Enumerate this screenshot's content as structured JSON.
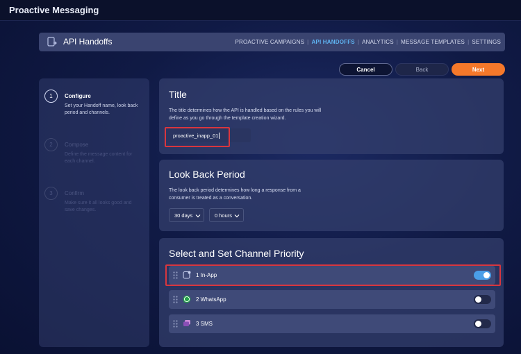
{
  "app": {
    "title": "Proactive Messaging"
  },
  "header": {
    "title": "API Handoffs",
    "nav": [
      {
        "label": "PROACTIVE CAMPAIGNS",
        "active": false
      },
      {
        "label": "API HANDOFFS",
        "active": true
      },
      {
        "label": "ANALYTICS",
        "active": false
      },
      {
        "label": "MESSAGE TEMPLATES",
        "active": false
      },
      {
        "label": "SETTINGS",
        "active": false
      }
    ]
  },
  "actions": {
    "cancel": "Cancel",
    "back": "Back",
    "next": "Next"
  },
  "steps": [
    {
      "number": "1",
      "title": "Configure",
      "description": "Set your Handoff name, look back period and channels.",
      "state": "active"
    },
    {
      "number": "2",
      "title": "Compose",
      "description": "Define the message content for each channel.",
      "state": "inactive"
    },
    {
      "number": "3",
      "title": "Confirm",
      "description": "Make sure it all looks good and save changes.",
      "state": "inactive"
    }
  ],
  "title_section": {
    "heading": "Title",
    "description": "The title determines how the API is handled based on the rules you will define as you go through the template creation wizard.",
    "value": "proactive_inapp_01"
  },
  "lookback_section": {
    "heading": "Look Back Period",
    "description": "The look back period determines how long a response from a consumer is treated as a conversation.",
    "days": "30 days",
    "hours": "0 hours"
  },
  "channels_section": {
    "heading": "Select and Set Channel Priority",
    "channels": [
      {
        "label": "1 In-App",
        "icon": "in-app-icon",
        "enabled": true
      },
      {
        "label": "2 WhatsApp",
        "icon": "whatsapp-icon",
        "enabled": false
      },
      {
        "label": "3 SMS",
        "icon": "sms-icon",
        "enabled": false
      }
    ]
  },
  "colors": {
    "accent": "#5fb4f2",
    "primary_button": "#f5782a",
    "highlight": "#d9363e",
    "toggle_on": "#4a9ee8"
  }
}
